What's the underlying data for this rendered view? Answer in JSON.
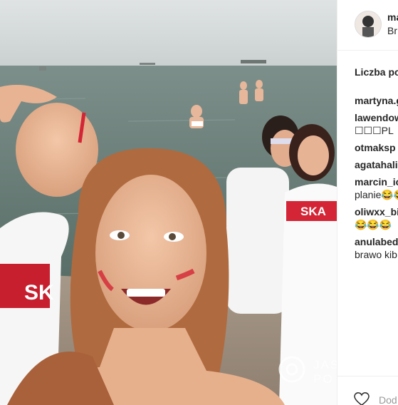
{
  "post": {
    "username": "ma",
    "location": "Br",
    "likes_label": "Liczba po",
    "comments": [
      {
        "user": "martyna.g",
        "text": ""
      },
      {
        "user": "lawendow",
        "text": "☐☐☐PL"
      },
      {
        "user": "otmaksp",
        "text": ""
      },
      {
        "user": "agatahali",
        "text": ""
      },
      {
        "user": "marcin_ic",
        "text": "planie😂😂"
      },
      {
        "user": "oliwxx_bi",
        "text": "😂😂😂"
      },
      {
        "user": "anulabed",
        "text": "brawo kib"
      }
    ],
    "add_comment_placeholder": "Dod"
  },
  "watermark": {
    "line1": "JAS",
    "line2": "PO"
  },
  "shirt_text_left": "SK",
  "shirt_text_right": "SKA",
  "icons": {
    "like": "heart-icon",
    "watermark_logo": "camera-logo-icon"
  },
  "colors": {
    "accent_red": "#d32535",
    "divider": "#efefef"
  }
}
